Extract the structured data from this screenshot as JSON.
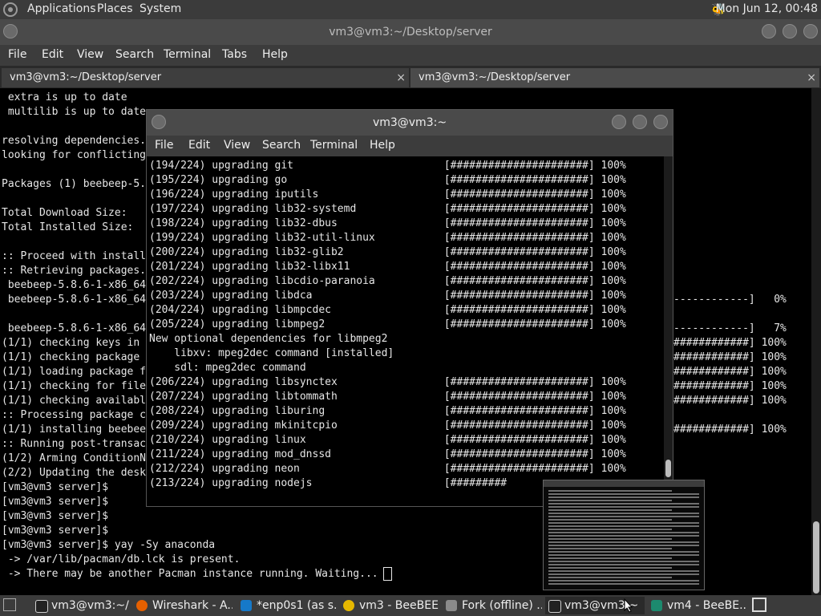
{
  "top_panel": {
    "menus": [
      "Applications",
      "Places",
      "System"
    ],
    "clock": "Mon Jun 12, 00:48",
    "tray_icon": "bee-icon"
  },
  "main_window": {
    "title": "vm3@vm3:~/Desktop/server",
    "menu": [
      "File",
      "Edit",
      "View",
      "Search",
      "Terminal",
      "Tabs",
      "Help"
    ],
    "tabs": [
      {
        "label": "vm3@vm3:~/Desktop/server",
        "close": "×"
      },
      {
        "label": "vm3@vm3:~/Desktop/server",
        "close": "×"
      }
    ],
    "left_lines": [
      " extra is up to date",
      " multilib is up to date",
      "",
      "resolving dependencies.",
      "looking for conflicting",
      "",
      "Packages (1) beebeep-5.",
      "",
      "Total Download Size:",
      "Total Installed Size:",
      "",
      ":: Proceed with install",
      ":: Retrieving packages.",
      " beebeep-5.8.6-1-x86_64",
      " beebeep-5.8.6-1-x86_64",
      "",
      " beebeep-5.8.6-1-x86_64",
      "(1/1) checking keys in",
      "(1/1) checking package",
      "(1/1) loading package f",
      "(1/1) checking for file",
      "(1/1) checking availabl",
      ":: Processing package c",
      "(1/1) installing beebee",
      ":: Running post-transac",
      "(1/2) Arming ConditionN",
      "(2/2) Updating the desk",
      "[vm3@vm3 server]$",
      "[vm3@vm3 server]$",
      "[vm3@vm3 server]$",
      "[vm3@vm3 server]$",
      "[vm3@vm3 server]$ yay -Sy anaconda",
      " -> /var/lib/pacman/db.lck is present.",
      " -> There may be another Pacman instance running. Waiting..."
    ],
    "right_lines": [
      "",
      "",
      "",
      "",
      "",
      "",
      "",
      "",
      "",
      "",
      "",
      "",
      "",
      "",
      "------------]   0%",
      "",
      "------------]   7%",
      "############] 100%",
      "############] 100%",
      "############] 100%",
      "############] 100%",
      "############] 100%",
      "",
      "############] 100%"
    ]
  },
  "overlay_window": {
    "title": "vm3@vm3:~",
    "menu": [
      "File",
      "Edit",
      "View",
      "Search",
      "Terminal",
      "Help"
    ],
    "lines": [
      "(194/224) upgrading git                        [######################] 100%",
      "(195/224) upgrading go                         [######################] 100%",
      "(196/224) upgrading iputils                    [######################] 100%",
      "(197/224) upgrading lib32-systemd              [######################] 100%",
      "(198/224) upgrading lib32-dbus                 [######################] 100%",
      "(199/224) upgrading lib32-util-linux           [######################] 100%",
      "(200/224) upgrading lib32-glib2                [######################] 100%",
      "(201/224) upgrading lib32-libx11               [######################] 100%",
      "(202/224) upgrading libcdio-paranoia           [######################] 100%",
      "(203/224) upgrading libdca                     [######################] 100%",
      "(204/224) upgrading libmpcdec                  [######################] 100%",
      "(205/224) upgrading libmpeg2                   [######################] 100%",
      "New optional dependencies for libmpeg2",
      "    libxv: mpeg2dec command [installed]",
      "    sdl: mpeg2dec command",
      "(206/224) upgrading libsynctex                 [######################] 100%",
      "(207/224) upgrading libtommath                 [######################] 100%",
      "(208/224) upgrading liburing                   [######################] 100%",
      "(209/224) upgrading mkinitcpio                 [######################] 100%",
      "(210/224) upgrading linux                      [######################] 100%",
      "(211/224) upgrading mod_dnssd                  [######################] 100%",
      "(212/224) upgrading neon                       [######################] 100%",
      "(213/224) upgrading nodejs                     [#########"
    ]
  },
  "taskbar": {
    "items": [
      {
        "label": "vm3@vm3:~/...",
        "icon": "terminal-icon",
        "color": "#cfcfcf"
      },
      {
        "label": "Wireshark - A...",
        "icon": "firefox-icon",
        "color": "#e66000"
      },
      {
        "label": "*enp0s1 (as s...",
        "icon": "wireshark-icon",
        "color": "#1679c9"
      },
      {
        "label": "vm3 - BeeBEEP",
        "icon": "bee-icon",
        "color": "#e6b800"
      },
      {
        "label": "Fork (offline) ...",
        "icon": "fork-icon",
        "color": "#8a8a8a"
      },
      {
        "label": "vm3@vm3:~",
        "icon": "terminal-icon",
        "color": "#cfcfcf"
      },
      {
        "label": "vm4 - BeeBE...",
        "icon": "vm-icon",
        "color": "#1c8a6e"
      }
    ]
  }
}
